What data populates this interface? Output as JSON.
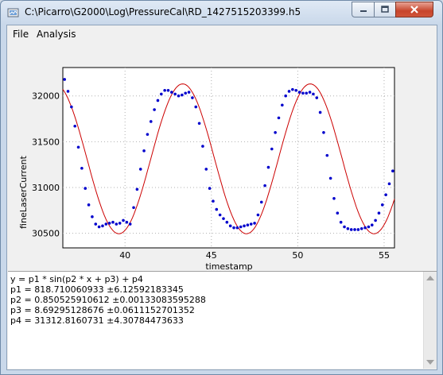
{
  "window": {
    "title": "C:\\Picarro\\G2000\\Log\\PressureCal\\RD_1427515203399.h5"
  },
  "menu": {
    "items": [
      "File",
      "Analysis"
    ]
  },
  "fit_results": {
    "lines": [
      "y = p1 * sin(p2 * x + p3) + p4",
      "p1 = 818.710060933 ±6.12592183345",
      "p2 = 0.850525910612 ±0.00133083595288",
      "p3 = 8.69295128676 ±0.0611152701352",
      "p4 = 31312.8160731 ±4.30784473633"
    ]
  },
  "colors": {
    "data_points": "#0000cc",
    "fit_line": "#cc0000",
    "plot_background": "#ffffff",
    "grid": "#b0b0b0"
  },
  "chart_data": {
    "type": "scatter",
    "xlabel": "timestamp",
    "ylabel": "fineLaserCurrent",
    "xlim": [
      36.4,
      55.6
    ],
    "ylim": [
      30340,
      32310
    ],
    "xticks": [
      40,
      45,
      50,
      55
    ],
    "yticks": [
      30500,
      31000,
      31500,
      32000
    ],
    "grid": true,
    "series": [
      {
        "kind": "points",
        "x": [
          36.5,
          36.7,
          36.9,
          37.1,
          37.3,
          37.5,
          37.7,
          37.9,
          38.1,
          38.3,
          38.5,
          38.7,
          38.9,
          39.1,
          39.3,
          39.5,
          39.7,
          39.9,
          40.1,
          40.3,
          40.5,
          40.7,
          40.9,
          41.1,
          41.3,
          41.5,
          41.7,
          41.9,
          42.1,
          42.3,
          42.5,
          42.7,
          42.9,
          43.1,
          43.3,
          43.5,
          43.7,
          43.9,
          44.1,
          44.3,
          44.5,
          44.7,
          44.9,
          45.1,
          45.3,
          45.5,
          45.7,
          45.9,
          46.1,
          46.3,
          46.5,
          46.7,
          46.9,
          47.1,
          47.3,
          47.5,
          47.7,
          47.9,
          48.1,
          48.3,
          48.5,
          48.7,
          48.9,
          49.1,
          49.3,
          49.5,
          49.7,
          49.9,
          50.1,
          50.3,
          50.5,
          50.7,
          50.9,
          51.1,
          51.3,
          51.5,
          51.7,
          51.9,
          52.1,
          52.3,
          52.5,
          52.7,
          52.9,
          53.1,
          53.3,
          53.5,
          53.7,
          53.9,
          54.1,
          54.3,
          54.5,
          54.7,
          54.9,
          55.1,
          55.3,
          55.5
        ],
        "y": [
          32180,
          32050,
          31880,
          31670,
          31440,
          31210,
          30990,
          30810,
          30680,
          30600,
          30570,
          30580,
          30600,
          30610,
          30620,
          30600,
          30610,
          30640,
          30620,
          30600,
          30780,
          30980,
          31200,
          31400,
          31580,
          31720,
          31850,
          31950,
          32020,
          32060,
          32060,
          32040,
          32020,
          32000,
          32010,
          32030,
          32040,
          31980,
          31880,
          31700,
          31450,
          31200,
          30990,
          30850,
          30760,
          30700,
          30660,
          30620,
          30580,
          30560,
          30560,
          30570,
          30580,
          30590,
          30600,
          30610,
          30700,
          30840,
          31020,
          31220,
          31420,
          31600,
          31760,
          31900,
          32000,
          32050,
          32070,
          32060,
          32040,
          32030,
          32030,
          32040,
          32020,
          31980,
          31820,
          31600,
          31350,
          31100,
          30880,
          30720,
          30620,
          30570,
          30550,
          30540,
          30540,
          30540,
          30550,
          30560,
          30570,
          30590,
          30640,
          30720,
          30810,
          30920,
          31040,
          31180
        ]
      },
      {
        "kind": "fit"
      }
    ]
  }
}
